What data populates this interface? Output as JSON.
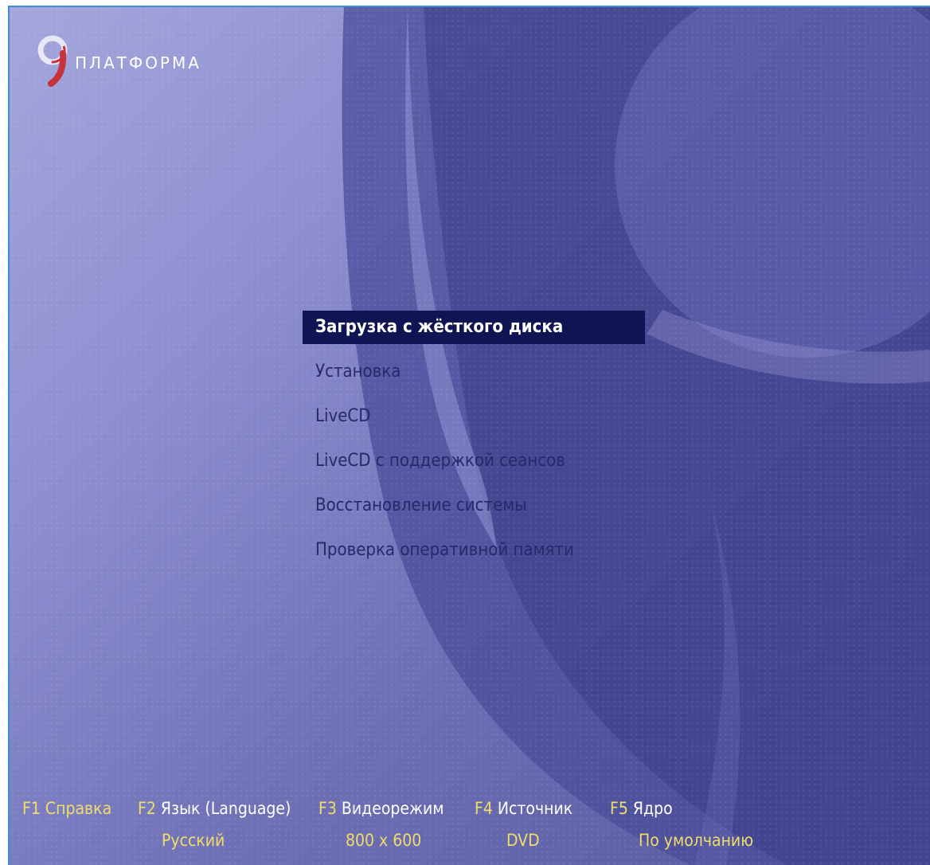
{
  "logo": {
    "glyph": "9",
    "text": "ПЛАТФОРМА"
  },
  "menu": {
    "items": [
      {
        "label": "Загрузка с жёсткого диска",
        "selected": true
      },
      {
        "label": "Установка",
        "selected": false
      },
      {
        "label": "LiveCD",
        "selected": false
      },
      {
        "label": "LiveCD с поддержкой сеансов",
        "selected": false
      },
      {
        "label": "Восстановление системы",
        "selected": false
      },
      {
        "label": "Проверка оперативной памяти",
        "selected": false
      }
    ]
  },
  "function_keys": [
    {
      "key": "F1",
      "label": "Справка",
      "value": ""
    },
    {
      "key": "F2",
      "label": "Язык (Language)",
      "value": "Русский"
    },
    {
      "key": "F3",
      "label": "Видеорежим",
      "value": "800 x 600"
    },
    {
      "key": "F4",
      "label": "Источник",
      "value": "DVD"
    },
    {
      "key": "F5",
      "label": "Ядро",
      "value": "По умолчанию"
    }
  ],
  "colors": {
    "selection_bg": "#0f1452",
    "key_yellow": "#f0dc6a",
    "menu_text": "#27296a",
    "logo_red": "#c8323c"
  }
}
